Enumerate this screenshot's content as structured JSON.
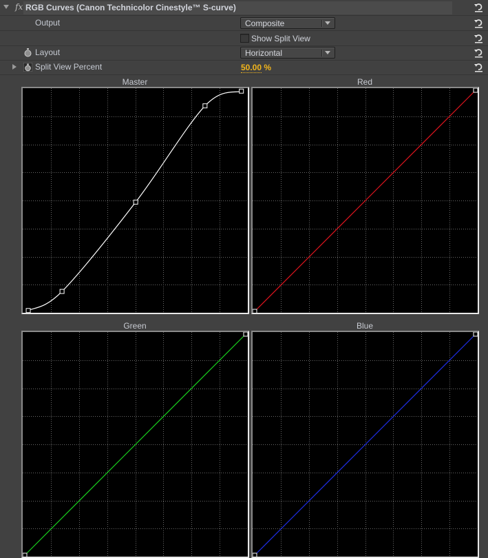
{
  "effect": {
    "fx_label": "fx",
    "title": "RGB Curves (Canon Technicolor Cinestyle™ S-curve)",
    "expanded": true
  },
  "params": {
    "output": {
      "label": "Output",
      "value": "Composite"
    },
    "show_split_view": {
      "label": "Show Split View",
      "checked": false
    },
    "layout": {
      "label": "Layout",
      "value": "Horizontal"
    },
    "split_view_percent": {
      "label": "Split View Percent",
      "value": "50.00",
      "unit": "%"
    }
  },
  "colors": {
    "master": "#ffffff",
    "red": "#e0141e",
    "green": "#19d21e",
    "blue": "#1e2ee6",
    "value_accent": "#f1b51c"
  },
  "graphs": {
    "master": {
      "title": "Master",
      "points": [
        [
          4,
          1
        ],
        [
          43,
          23
        ],
        [
          128,
          126
        ],
        [
          208,
          237
        ],
        [
          250,
          254
        ]
      ]
    },
    "red": {
      "title": "Red",
      "points": [
        [
          0,
          0
        ],
        [
          255,
          255
        ]
      ]
    },
    "green": {
      "title": "Green",
      "points": [
        [
          0,
          0
        ],
        [
          255,
          255
        ]
      ]
    },
    "blue": {
      "title": "Blue",
      "points": [
        [
          0,
          0
        ],
        [
          255,
          255
        ]
      ]
    }
  }
}
